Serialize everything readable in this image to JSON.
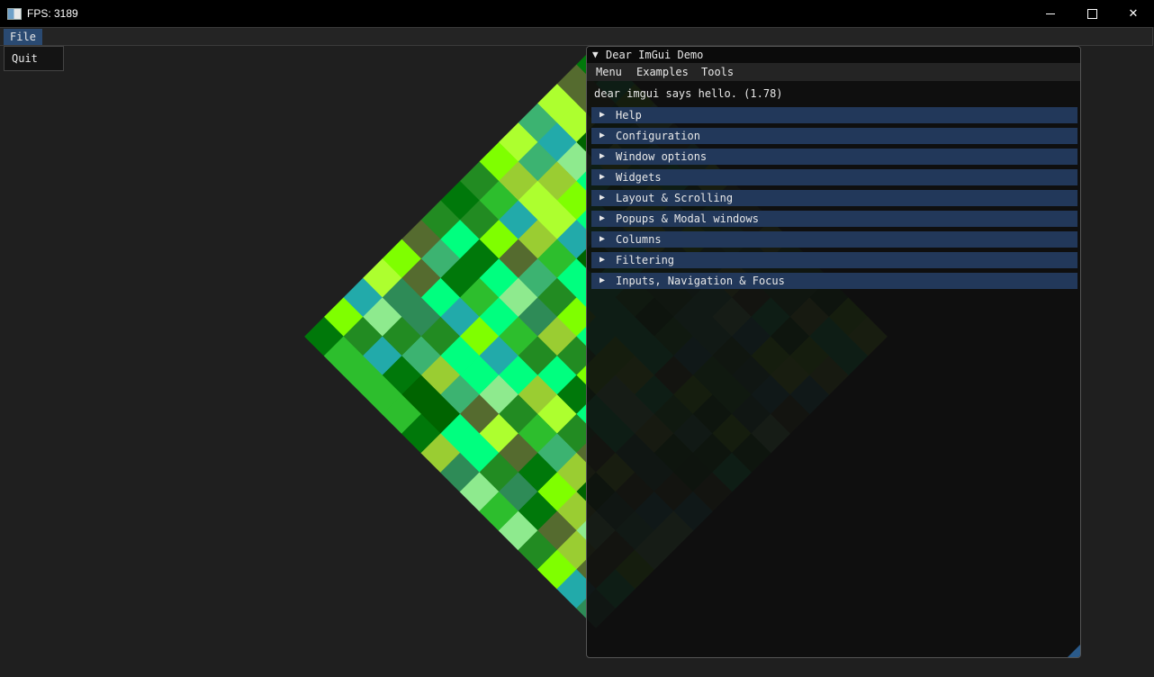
{
  "window": {
    "title": "FPS: 3189"
  },
  "main_menu": {
    "file_label": "File",
    "file_popup": {
      "quit_label": "Quit"
    }
  },
  "demo": {
    "title": "Dear ImGui Demo",
    "menu": [
      "Menu",
      "Examples",
      "Tools"
    ],
    "hello_text": "dear imgui says hello. (1.78)",
    "headers": [
      {
        "label": "Help"
      },
      {
        "label": "Configuration"
      },
      {
        "label": "Window options"
      },
      {
        "label": "Widgets"
      },
      {
        "label": "Layout & Scrolling"
      },
      {
        "label": "Popups & Modal windows"
      },
      {
        "label": "Columns"
      },
      {
        "label": "Filtering"
      },
      {
        "label": "Inputs, Navigation & Focus"
      }
    ]
  },
  "colors": {
    "background": "#1f1f1f",
    "header_bg": "#22385a",
    "menu_highlight": "#2a4a72",
    "mosaic_palette": [
      "#00780a",
      "#2dbe2d",
      "#8eea8e",
      "#7fff00",
      "#adff2f",
      "#22aaaa",
      "#3cb371",
      "#9acd32",
      "#228b22",
      "#556b2f",
      "#006400",
      "#00ff7f",
      "#2e8b57"
    ]
  }
}
